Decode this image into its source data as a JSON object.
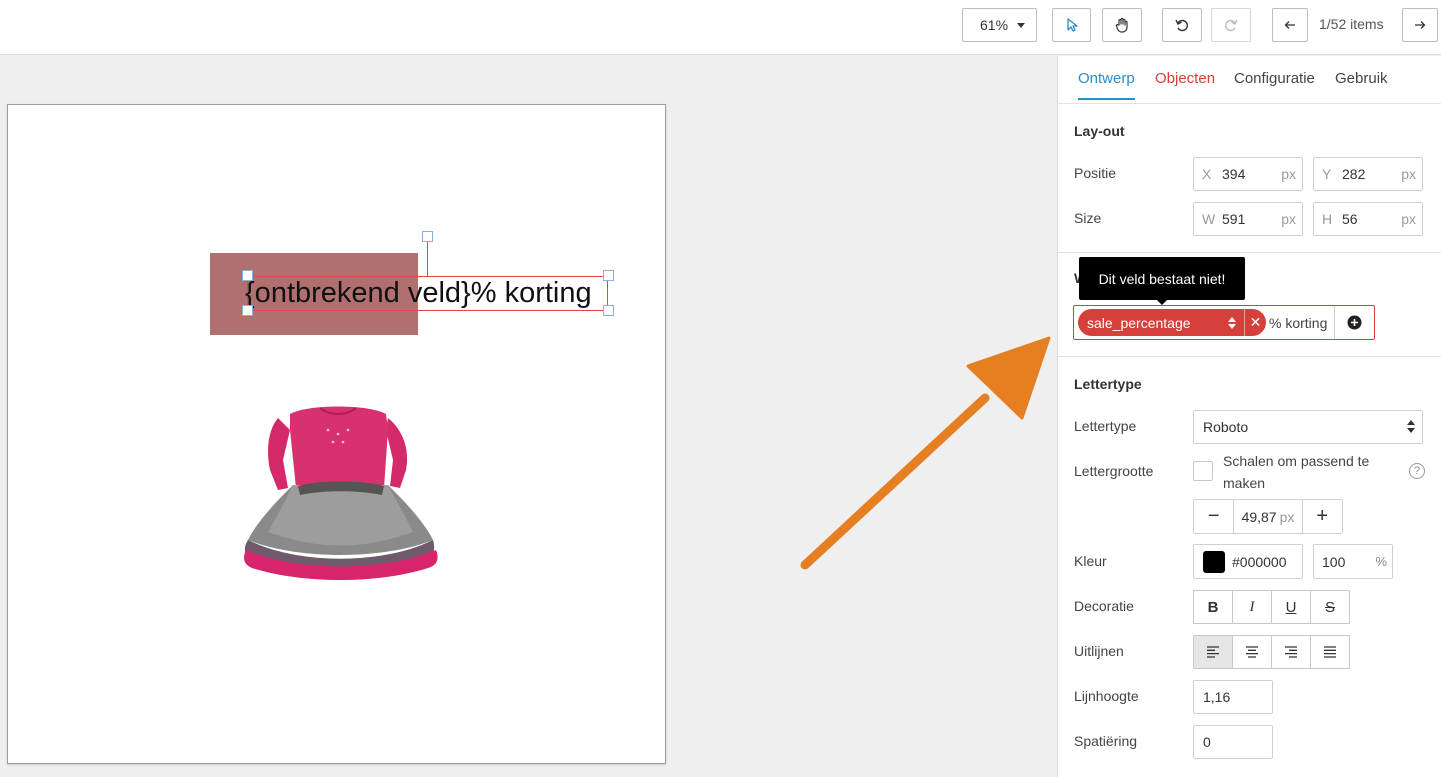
{
  "toolbar": {
    "zoom": "61%",
    "pagination": "1/52 items"
  },
  "canvas": {
    "text": "{ontbrekend veld}% korting",
    "product_image": "pink-dress-with-grey-tulle-skirt"
  },
  "panel": {
    "tabs": [
      "Ontwerp",
      "Objecten",
      "Configuratie",
      "Gebruik"
    ],
    "layout": {
      "title": "Lay-out",
      "position_label": "Positie",
      "size_label": "Size",
      "x_prefix": "X",
      "x_value": "394",
      "y_prefix": "Y",
      "y_value": "282",
      "w_prefix": "W",
      "w_value": "591",
      "h_prefix": "H",
      "h_value": "56",
      "unit": "px"
    },
    "value": {
      "title_fragment": "W",
      "tooltip": "Dit veld bestaat niet!",
      "token": "sale_percentage",
      "suffix": "% korting"
    },
    "font": {
      "title": "Lettertype",
      "font_label": "Lettertype",
      "font_value": "Roboto",
      "size_label": "Lettergrootte",
      "scale_label": "Schalen om passend te maken",
      "size_value": "49,87",
      "size_unit": "px",
      "color_label": "Kleur",
      "color_value": "#000000",
      "opacity_value": "100",
      "opacity_unit": "%",
      "decoration_label": "Decoratie",
      "align_label": "Uitlijnen",
      "lineheight_label": "Lijnhoogte",
      "lineheight_value": "1,16",
      "spacing_label": "Spatiëring",
      "spacing_value": "0"
    }
  },
  "colors": {
    "accent": "#2a8fc4",
    "error": "#d6403a",
    "arrow": "#e67e22"
  }
}
